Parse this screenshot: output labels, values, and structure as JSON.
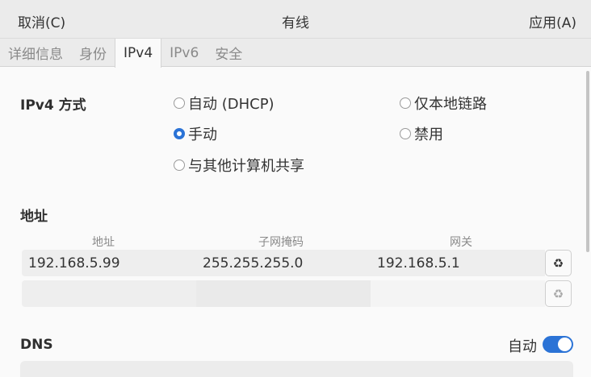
{
  "header": {
    "cancel": "取消(C)",
    "title": "有线",
    "apply": "应用(A)"
  },
  "tabs": [
    {
      "label": "详细信息"
    },
    {
      "label": "身份"
    },
    {
      "label": "IPv4"
    },
    {
      "label": "IPv6"
    },
    {
      "label": "安全"
    }
  ],
  "active_tab": "IPv4",
  "ipv4_method": {
    "label": "IPv4 方式",
    "options": [
      {
        "label": "自动 (DHCP)",
        "selected": false
      },
      {
        "label": "仅本地链路",
        "selected": false
      },
      {
        "label": "手动",
        "selected": true
      },
      {
        "label": "禁用",
        "selected": false
      },
      {
        "label": "与其他计算机共享",
        "selected": false
      }
    ]
  },
  "addresses": {
    "label": "地址",
    "columns": [
      "地址",
      "子网掩码",
      "网关"
    ],
    "rows": [
      {
        "address": "192.168.5.99",
        "netmask": "255.255.255.0",
        "gateway": "192.168.5.1"
      },
      {
        "address": "",
        "netmask": "",
        "gateway": ""
      }
    ],
    "delete_icon": "recycle-icon"
  },
  "dns": {
    "label": "DNS",
    "auto_label": "自动",
    "auto_enabled": true
  },
  "colors": {
    "accent": "#2b73d6",
    "header_bg": "#ebebeb",
    "bg": "#fafafa"
  }
}
